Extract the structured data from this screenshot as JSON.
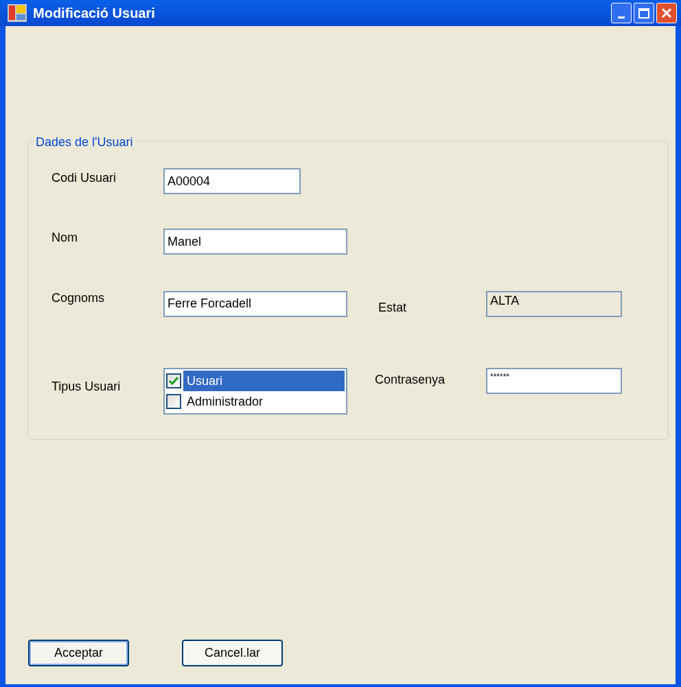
{
  "window": {
    "title": "Modificació Usuari"
  },
  "group": {
    "title": "Dades de l'Usuari"
  },
  "fields": {
    "codi": {
      "label": "Codi Usuari",
      "value": "A00004"
    },
    "nom": {
      "label": "Nom",
      "value": "Manel"
    },
    "cognoms": {
      "label": "Cognoms",
      "value": "Ferre Forcadell"
    },
    "estat": {
      "label": "Estat",
      "value": "ALTA",
      "disabled": true
    },
    "tipus": {
      "label": "Tipus Usuari",
      "options": [
        {
          "label": "Usuari",
          "checked": true,
          "selected": true
        },
        {
          "label": "Administrador",
          "checked": false,
          "selected": false
        }
      ]
    },
    "contrasenya": {
      "label": "Contrasenya",
      "value": "******"
    }
  },
  "buttons": [
    {
      "label": "Acceptar",
      "default": true
    },
    {
      "label": "Cancel.lar",
      "default": false
    }
  ]
}
